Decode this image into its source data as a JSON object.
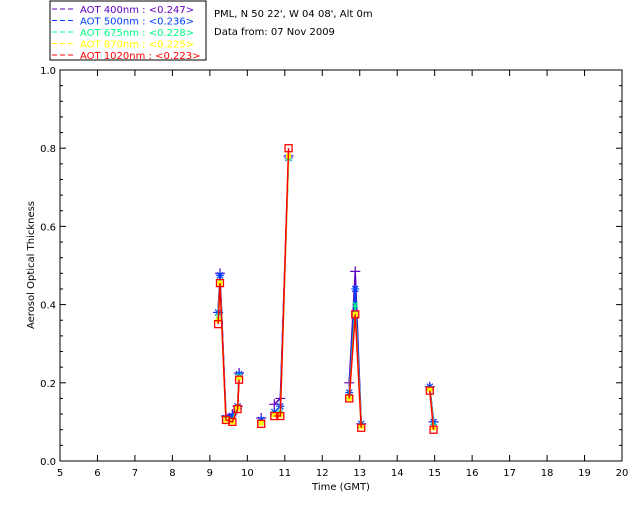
{
  "header": {
    "site": "PML, N 50 22', W 04 08', Alt 0m",
    "date": "Data from: 07 Nov 2009"
  },
  "chart_data": {
    "type": "line",
    "title": "",
    "xlabel": "Time (GMT)",
    "ylabel": "Aerosol Optical Thickness",
    "xlim": [
      5,
      20
    ],
    "ylim": [
      0.0,
      1.0
    ],
    "xticks": [
      "5",
      "6",
      "7",
      "8",
      "9",
      "10",
      "11",
      "12",
      "13",
      "14",
      "15",
      "16",
      "17",
      "18",
      "19",
      "20"
    ],
    "yticks": [
      "0.0",
      "0.2",
      "0.4",
      "0.6",
      "0.8",
      "1.0"
    ],
    "grid": false,
    "legend_position": "top-left",
    "x": [
      9.22,
      9.27,
      9.43,
      9.6,
      9.74,
      9.78,
      10.37,
      10.72,
      10.88,
      11.1,
      12.72,
      12.88,
      13.04,
      14.87,
      14.97
    ],
    "segments": [
      [
        0,
        5
      ],
      [
        6,
        6
      ],
      [
        7,
        9
      ],
      [
        10,
        12
      ],
      [
        13,
        14
      ]
    ],
    "series": [
      {
        "name": "AOT  400nm : <0.247>",
        "color": "#6000c0",
        "marker": "plus",
        "values": [
          0.38,
          0.48,
          0.115,
          0.12,
          0.14,
          0.225,
          0.11,
          0.145,
          0.16,
          0.78,
          0.2,
          0.485,
          0.095,
          0.19,
          0.1
        ]
      },
      {
        "name": "AOT  500nm : <0.236>",
        "color": "#0040ff",
        "marker": "asterisk",
        "values": [
          0.38,
          0.475,
          0.11,
          0.115,
          0.14,
          0.222,
          0.105,
          0.125,
          0.14,
          0.775,
          0.175,
          0.44,
          0.095,
          0.19,
          0.1
        ]
      },
      {
        "name": "AOT  675nm : <0.228>",
        "color": "#00ff80",
        "marker": "x",
        "values": [
          0.37,
          0.46,
          0.105,
          0.105,
          0.138,
          0.218,
          0.1,
          0.12,
          0.125,
          0.775,
          0.165,
          0.4,
          0.09,
          0.185,
          0.09
        ]
      },
      {
        "name": "AOT  870nm : <0.225>",
        "color": "#ffff00",
        "marker": "dot",
        "values": [
          0.36,
          0.455,
          0.105,
          0.1,
          0.135,
          0.212,
          0.097,
          0.118,
          0.118,
          0.78,
          0.16,
          0.375,
          0.088,
          0.183,
          0.085
        ]
      },
      {
        "name": "AOT 1020nm : <0.223>",
        "color": "#ff0000",
        "marker": "square",
        "values": [
          0.35,
          0.455,
          0.105,
          0.1,
          0.133,
          0.208,
          0.095,
          0.115,
          0.115,
          0.8,
          0.16,
          0.375,
          0.085,
          0.18,
          0.08
        ]
      }
    ]
  }
}
